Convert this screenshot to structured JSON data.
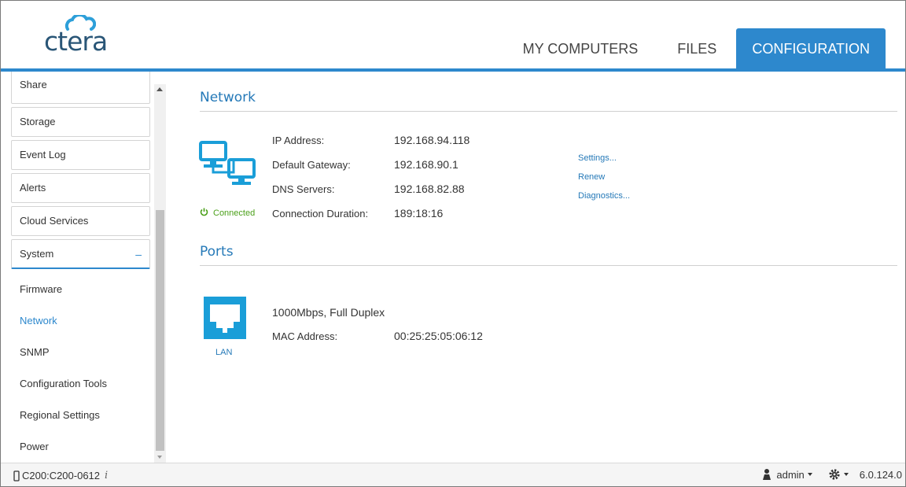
{
  "brand": {
    "logo_text": "ctera",
    "accent": "#2d88cd"
  },
  "header": {
    "tabs": [
      {
        "label": "MY COMPUTERS",
        "active": false
      },
      {
        "label": "FILES",
        "active": false
      },
      {
        "label": "CONFIGURATION",
        "active": true
      }
    ]
  },
  "sidebar": {
    "groups": [
      "Share",
      "Storage",
      "Event Log",
      "Alerts",
      "Cloud Services",
      "System"
    ],
    "system_toggle": "–",
    "system_items": [
      "Firmware",
      "Network",
      "SNMP",
      "Configuration Tools",
      "Regional Settings",
      "Power"
    ],
    "active_item": "Network"
  },
  "network": {
    "title": "Network",
    "status": "Connected",
    "fields": [
      {
        "label": "IP Address:",
        "value": "192.168.94.118"
      },
      {
        "label": "Default Gateway:",
        "value": "192.168.90.1"
      },
      {
        "label": "DNS Servers:",
        "value": "192.168.82.88"
      },
      {
        "label": "Connection Duration:",
        "value": "189:18:16"
      }
    ],
    "links": [
      "Settings...",
      "Renew",
      "Diagnostics..."
    ]
  },
  "ports": {
    "title": "Ports",
    "port_label": "LAN",
    "speed": "1000Mbps, Full Duplex",
    "mac_label": "MAC Address:",
    "mac_value": "00:25:25:05:06:12"
  },
  "statusbar": {
    "device": "C200:C200-0612",
    "info_glyph": "i",
    "user": "admin",
    "version": "6.0.124.0"
  }
}
